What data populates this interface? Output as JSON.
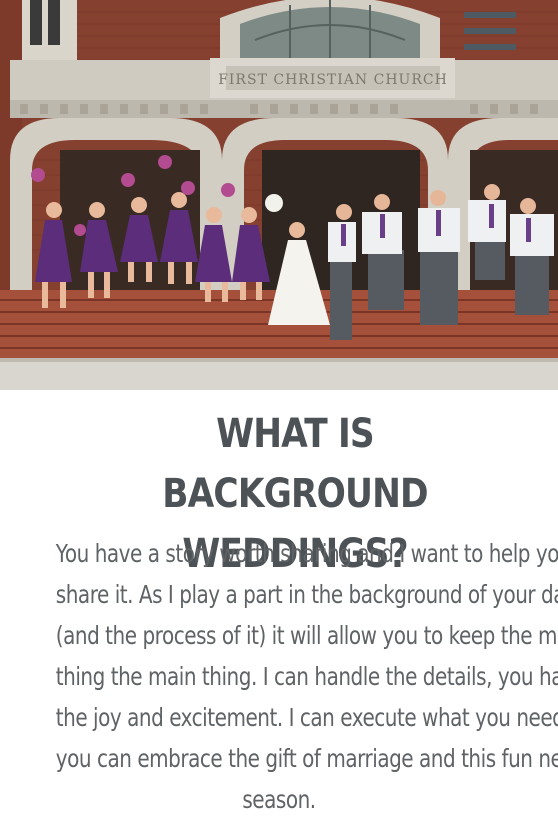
{
  "hero": {
    "image_alt": "Wedding party jumping on the steps of First Christian Church",
    "church_sign": "FIRST CHRISTIAN CHURCH"
  },
  "nav": {
    "menu_icon": "hamburger-menu-icon"
  },
  "section": {
    "heading_line1": "WHAT IS BACKGROUND",
    "heading_line2": "WEDDINGS?",
    "body_lines": [
      "You have a story worth sharing and I want to help you",
      "share it. As I play a part in the background of your day",
      "(and the process of it) it will allow you to keep the main",
      "thing the main thing. I can handle the details, you handle",
      "the joy and excitement. I can execute what you need so",
      "you can embrace the gift of marriage and this fun new",
      "season."
    ]
  },
  "colors": {
    "heading": "#4d5256",
    "body": "#5f6366",
    "menu_icon": "#4d5a63",
    "brick": "#8a3f2f",
    "stone": "#c9c5bb",
    "bridesmaid_dress": "#5b2d7a"
  }
}
